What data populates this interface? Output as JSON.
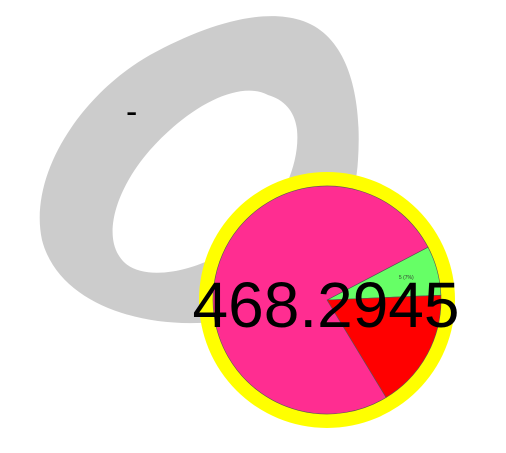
{
  "decor": {
    "dash_text": "-",
    "blob_color": "#cccccc"
  },
  "gauge": {
    "value_text": "468.2945",
    "ring_color": "#ffff00"
  },
  "chart_data": {
    "type": "pie",
    "title": "",
    "slices": [
      {
        "label": "",
        "value": 76,
        "color": "#ff2d91"
      },
      {
        "label": "5 (7%)",
        "value": 7,
        "color": "#66ff66"
      },
      {
        "label": "",
        "value": 17,
        "color": "#ff0000"
      }
    ],
    "legend": "none"
  }
}
